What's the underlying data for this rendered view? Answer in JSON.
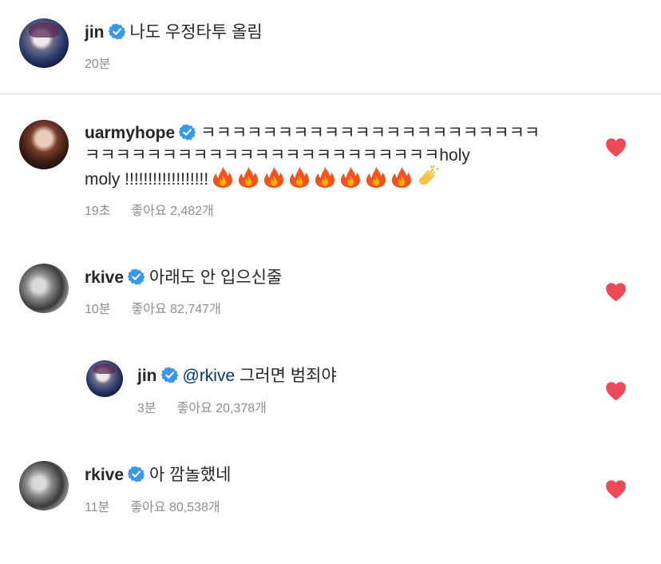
{
  "caption": {
    "username": "jin",
    "text": "나도 우정타투 올림",
    "time": "20분"
  },
  "comments": [
    {
      "username": "uarmyhope",
      "text_line1": "ㅋㅋㅋㅋㅋㅋㅋㅋㅋㅋㅋㅋㅋㅋㅋㅋㅋㅋㅋㅋㅋㅋ",
      "text_line2": "ㅋㅋㅋㅋㅋㅋㅋㅋㅋㅋㅋㅋㅋㅋㅋㅋㅋㅋㅋㅋㅋㅋㅋholy",
      "text_line3": "moly !!!!!!!!!!!!!!!!!!",
      "emojis": [
        "fire-icon",
        "fire-icon",
        "fire-icon",
        "fire-icon",
        "fire-icon",
        "fire-icon",
        "fire-icon",
        "fire-icon",
        "clap-icon"
      ],
      "time": "19초",
      "likes": "좋아요 2,482개"
    },
    {
      "username": "rkive",
      "text": "아래도 안 입으신줄",
      "time": "10분",
      "likes": "좋아요 82,747개"
    },
    {
      "username": "jin",
      "mention": "@rkive",
      "text": "그러면 범죄야",
      "time": "3분",
      "likes": "좋아요 20,378개",
      "is_reply": true
    },
    {
      "username": "rkive",
      "text": "아 깜놀했네",
      "time": "11분",
      "likes": "좋아요 80,538개"
    }
  ],
  "colors": {
    "heart": "#ed4956",
    "verified": "#3897f0",
    "meta": "#8e8e8e",
    "mention": "#00376b"
  }
}
